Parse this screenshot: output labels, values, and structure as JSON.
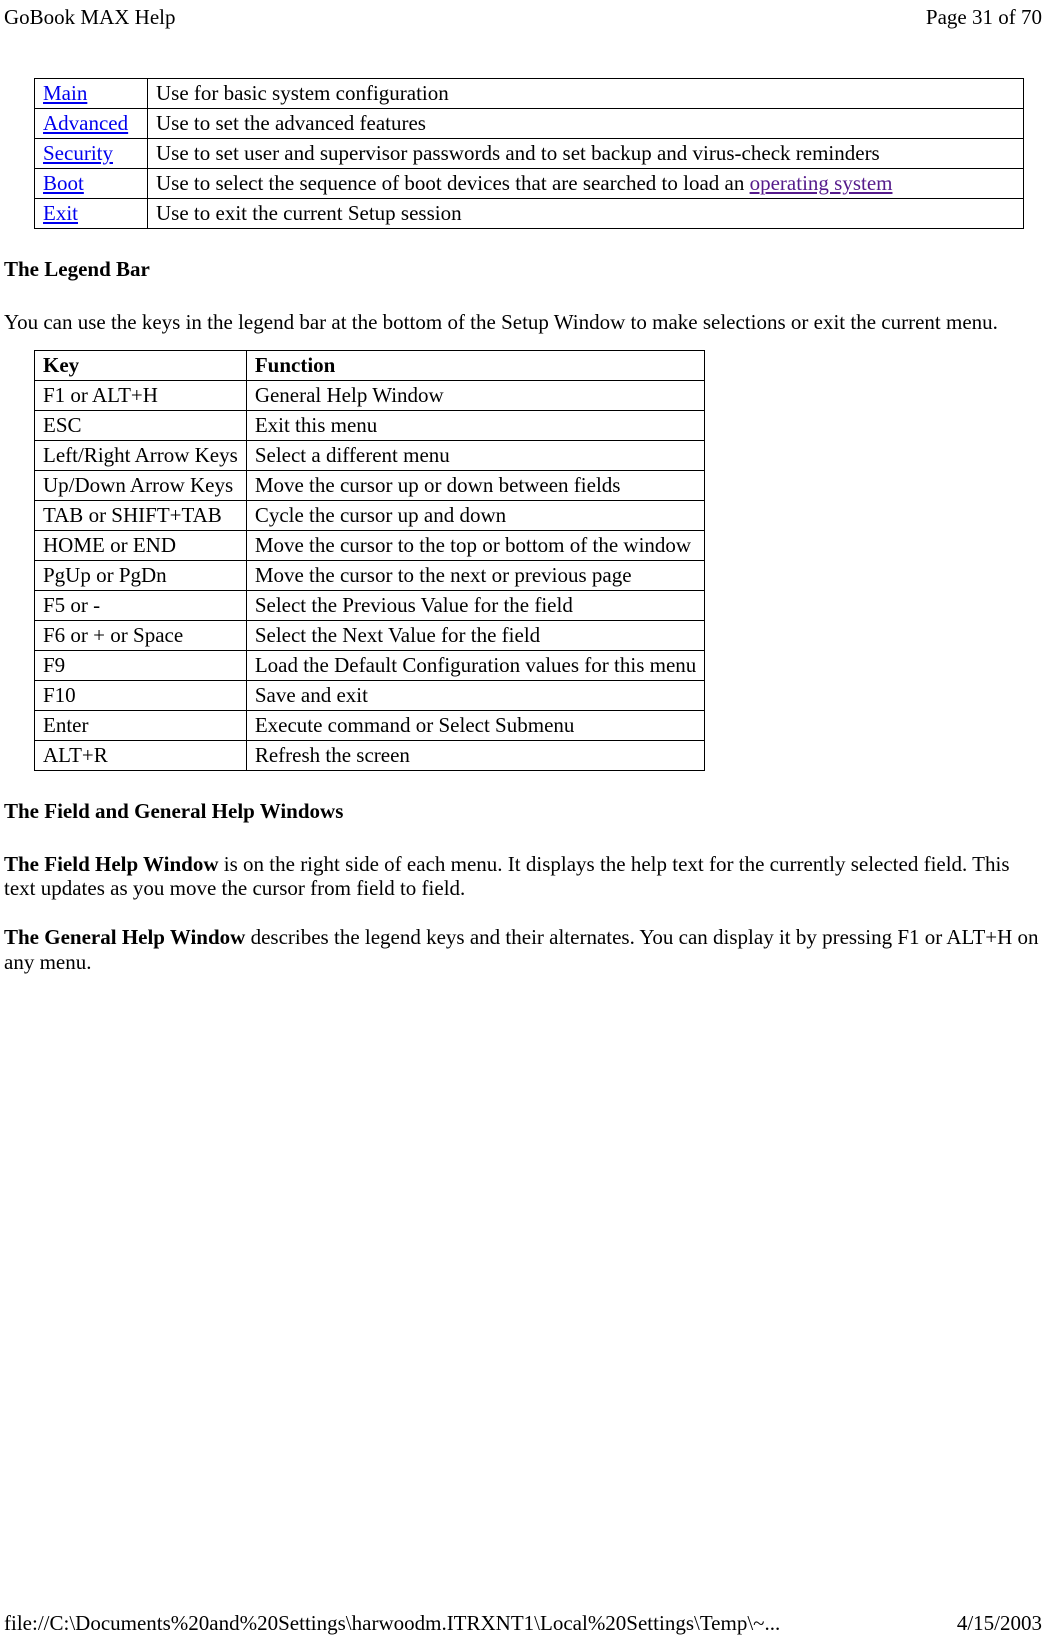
{
  "header": {
    "title": "GoBook MAX Help",
    "page_indicator": "Page 31 of 70"
  },
  "table1": {
    "rows": [
      {
        "link": "Main",
        "desc": "Use for basic system configuration"
      },
      {
        "link": "Advanced",
        "desc": "Use to set the advanced features"
      },
      {
        "link": "Security",
        "desc": "Use to set user and supervisor passwords and to set backup and virus-check reminders"
      },
      {
        "link": "Boot",
        "desc_prefix": "Use to select the sequence of boot devices that are searched to load an ",
        "desc_link": "operating system"
      },
      {
        "link": "Exit",
        "desc": "Use to exit the current Setup session"
      }
    ]
  },
  "section1": {
    "heading": "The Legend Bar",
    "text": "You can use the keys in the legend bar at the bottom of the Setup Window to make selections or exit the current menu."
  },
  "table2": {
    "headers": {
      "key": "Key",
      "function": "Function"
    },
    "rows": [
      {
        "key": "F1 or ALT+H",
        "function": "General Help Window"
      },
      {
        "key": "ESC",
        "function": "Exit this menu"
      },
      {
        "key": "Left/Right Arrow Keys",
        "function": "Select a different menu"
      },
      {
        "key": "Up/Down Arrow Keys",
        "function": "Move the cursor up or down between fields"
      },
      {
        "key": "TAB or SHIFT+TAB",
        "function": "Cycle the cursor up and down"
      },
      {
        "key": "HOME or END",
        "function": "Move the cursor to the top or bottom of the window"
      },
      {
        "key": "PgUp or PgDn",
        "function": "Move the cursor to the next or previous page"
      },
      {
        "key": "F5 or -",
        "function": "Select the Previous Value for the field"
      },
      {
        "key": "F6 or + or Space",
        "function": "Select the Next Value for the field"
      },
      {
        "key": "F9",
        "function": "Load the Default Configuration values for this menu"
      },
      {
        "key": "F10",
        "function": "Save and exit"
      },
      {
        "key": "Enter",
        "function": "Execute command or Select Submenu"
      },
      {
        "key": "ALT+R",
        "function": "Refresh the screen"
      }
    ]
  },
  "section2": {
    "heading": "The Field and General Help Windows",
    "para1_bold": "The Field Help Window",
    "para1_rest": " is on the right side of each menu.  It displays the help text for the currently selected field.  This text updates as you move the cursor from field to field.",
    "para2_bold": "The General Help Window",
    "para2_rest": " describes the legend keys and their alternates.  You can display it by pressing F1 or ALT+H on any menu."
  },
  "footer": {
    "path": "file://C:\\Documents%20and%20Settings\\harwoodm.ITRXNT1\\Local%20Settings\\Temp\\~...",
    "date": "4/15/2003"
  }
}
